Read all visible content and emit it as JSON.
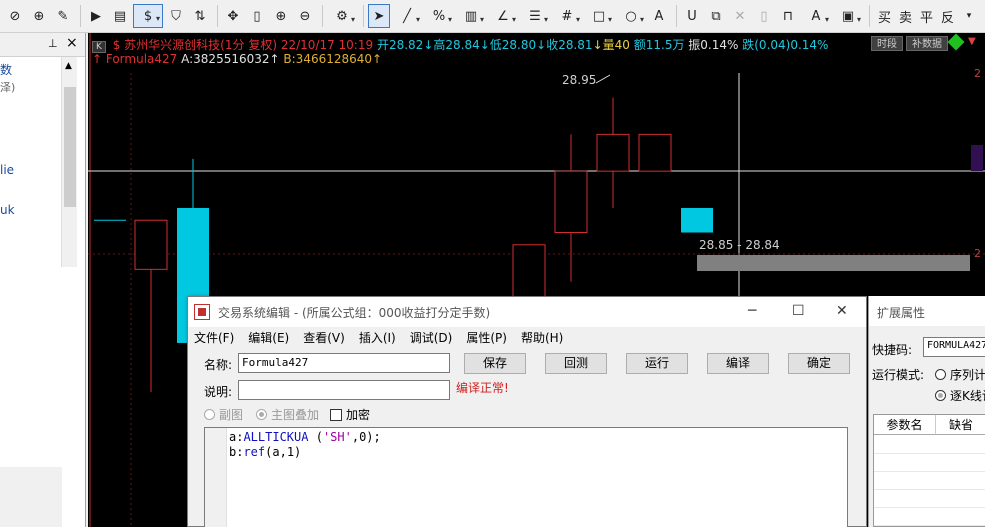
{
  "toolbar": {
    "currency_icon": "$",
    "text_buttons": [
      "买",
      "卖",
      "平",
      "反"
    ]
  },
  "left_panel": {
    "items": [
      "数",
      "泽)",
      "lie",
      "uk"
    ]
  },
  "chart": {
    "badge": "K",
    "stock_name": "$ 苏州华兴源创科技(1分 复权)",
    "datetime": "22/10/17 10:19",
    "open": "开28.82",
    "high": "↓高28.84",
    "low": "↓低28.80",
    "close": "↓收28.81",
    "volume": "↓量40",
    "amount": "额11.5万",
    "amplitude": "振0.14%",
    "change": "跌(0.04)0.14%",
    "formula_name": "↑ Formula427",
    "formula_a": "A:3825516032↑",
    "formula_b": "B:3466128640↑",
    "btn_timeframe": "时段",
    "btn_supplement": "补数据",
    "peak_label": "28.95",
    "range_label": "28.85 - 28.84",
    "y_ticks": [
      "2",
      "2",
      "2"
    ],
    "chart_data": {
      "type": "candlestick",
      "candles": [
        {
          "open": 28.85,
          "close": 28.85,
          "high": 28.85,
          "low": 28.85,
          "color": "cyan"
        },
        {
          "open": 28.81,
          "close": 28.85,
          "high": 28.85,
          "low": 28.71,
          "color": "red"
        },
        {
          "open": 28.86,
          "close": 28.75,
          "high": 28.9,
          "low": 28.75,
          "color": "cyan"
        },
        {
          "open": 28.72,
          "close": 28.83,
          "high": 28.83,
          "low": 28.7,
          "color": "red"
        },
        {
          "open": 28.84,
          "close": 28.89,
          "high": 28.92,
          "low": 28.8,
          "color": "red"
        },
        {
          "open": 28.89,
          "close": 28.92,
          "high": 28.95,
          "low": 28.86,
          "color": "red"
        },
        {
          "open": 28.89,
          "close": 28.92,
          "high": 28.92,
          "low": 28.89,
          "color": "red"
        },
        {
          "open": 28.86,
          "close": 28.84,
          "high": 28.86,
          "low": 28.84,
          "color": "cyan"
        }
      ]
    }
  },
  "dialog": {
    "title": "交易系统编辑 - (所属公式组：000收益打分定手数)",
    "menus": [
      "文件(F)",
      "编辑(E)",
      "查看(V)",
      "插入(I)",
      "调试(D)",
      "属性(P)",
      "帮助(H)"
    ],
    "name_label": "名称:",
    "name_value": "Formula427",
    "desc_label": "说明:",
    "desc_value": "",
    "buttons": [
      "保存",
      "回测",
      "运行",
      "编译",
      "确定"
    ],
    "status": "编译正常!",
    "radio_sub": "副图",
    "radio_main": "主图叠加",
    "check_encrypt": "加密",
    "code": {
      "line1_a": "a:",
      "line1_fn": "ALLTICKUA",
      "line1_open": " (",
      "line1_str": "'SH'",
      "line1_rest": ",0);",
      "line2_a": "b:",
      "line2_fn": "ref",
      "line2_rest": "(a,1)"
    }
  },
  "ext": {
    "title": "扩展属性",
    "shortcut_label": "快捷码:",
    "shortcut_value": "FORMULA427",
    "mode_label": "运行模式:",
    "mode_seq": "序列计",
    "mode_each": "逐K线计",
    "col_param": "参数名",
    "col_default": "缺省"
  }
}
